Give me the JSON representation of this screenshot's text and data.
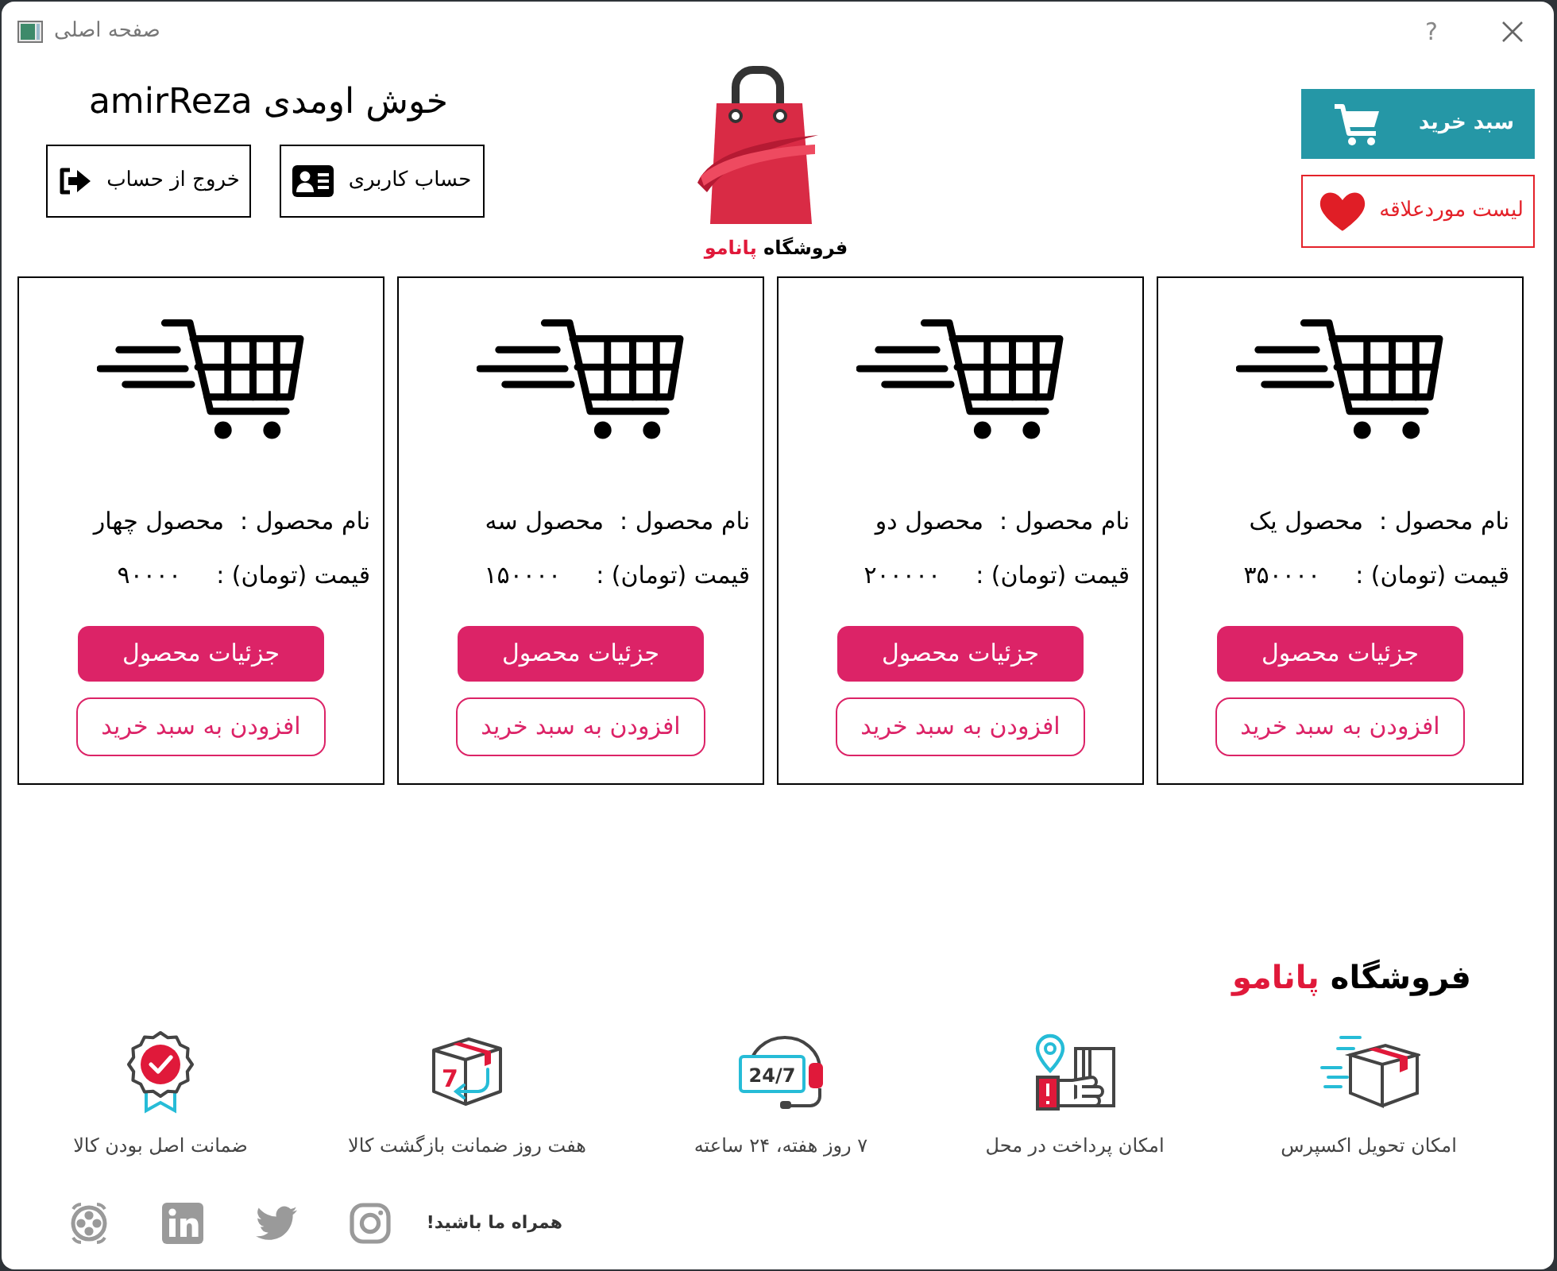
{
  "window": {
    "title": "صفحه اصلی",
    "help": "?"
  },
  "header": {
    "cart_button": "سبد خرید",
    "favorites_button": "لیست موردعلاقه",
    "logo": {
      "prefix": "فروشگاه",
      "name": "پانامو"
    },
    "welcome": "خوش اومدی amirReza",
    "account_buttons": [
      {
        "kind": "profile",
        "label": "حساب کاربری"
      },
      {
        "kind": "logout",
        "label": "خروج از حساب"
      }
    ]
  },
  "products": [
    {
      "name_label": "نام محصول :",
      "name": "محصول یک",
      "price_label": "قیمت (تومان) :",
      "price": "۳۵۰۰۰۰",
      "details_button": "جزئیات محصول",
      "add_button": "افزودن به سبد خرید"
    },
    {
      "name_label": "نام محصول :",
      "name": "محصول دو",
      "price_label": "قیمت (تومان) :",
      "price": "۲۰۰۰۰۰",
      "details_button": "جزئیات محصول",
      "add_button": "افزودن به سبد خرید"
    },
    {
      "name_label": "نام محصول :",
      "name": "محصول سه",
      "price_label": "قیمت (تومان) :",
      "price": "۱۵۰۰۰۰",
      "details_button": "جزئیات محصول",
      "add_button": "افزودن به سبد خرید"
    },
    {
      "name_label": "نام محصول :",
      "name": "محصول چهار",
      "price_label": "قیمت (تومان) :",
      "price": "۹۰۰۰۰",
      "details_button": "جزئیات محصول",
      "add_button": "افزودن به سبد خرید"
    }
  ],
  "footer": {
    "logo": {
      "prefix": "فروشگاه",
      "name": "پانامو"
    },
    "features": [
      {
        "kind": "express",
        "label": "امکان تحویل اکسپرس"
      },
      {
        "kind": "cod",
        "label": "امکان پرداخت در محل"
      },
      {
        "kind": "support",
        "label": "۷ روز هفته، ۲۴ ساعته",
        "icon_text": "24/7"
      },
      {
        "kind": "return",
        "label": "هفت روز ضمانت بازگشت کالا",
        "icon_text": "7"
      },
      {
        "kind": "original",
        "label": "ضمانت اصل بودن کالا"
      }
    ],
    "follow_label": "همراه ما باشید!"
  }
}
